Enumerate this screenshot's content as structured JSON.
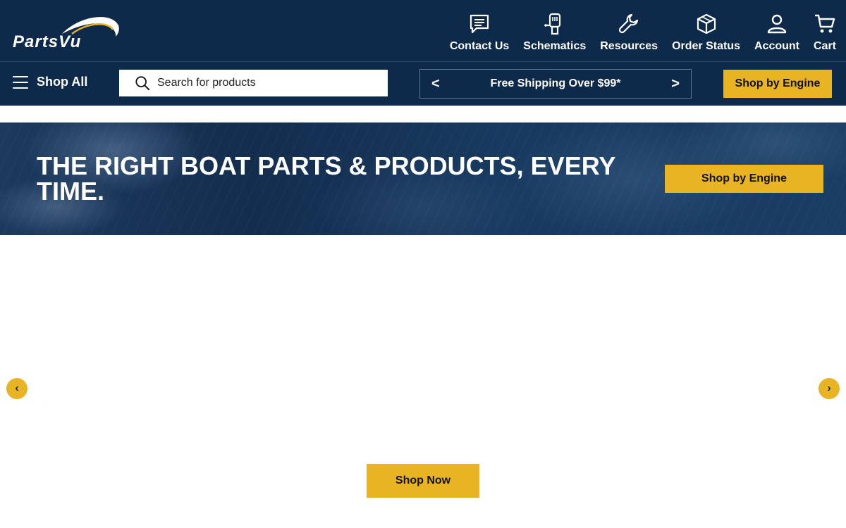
{
  "brand": {
    "logo_text": "PartsVu"
  },
  "nav": {
    "items": [
      {
        "label": "Contact Us",
        "icon": "chat-icon"
      },
      {
        "label": "Schematics",
        "icon": "schematic-icon"
      },
      {
        "label": "Resources",
        "icon": "wrench-icon"
      },
      {
        "label": "Order Status",
        "icon": "box-icon"
      },
      {
        "label": "Account",
        "icon": "user-icon"
      },
      {
        "label": "Cart",
        "icon": "cart-icon"
      }
    ]
  },
  "subbar": {
    "shop_all": "Shop All",
    "search_placeholder": "Search for products",
    "promo_prev": "<",
    "promo_text": "Free Shipping Over $99*",
    "promo_next": ">",
    "engine_button": "Shop by Engine"
  },
  "hero": {
    "title": "THE RIGHT BOAT PARTS & PRODUCTS, EVERY TIME.",
    "engine_button": "Shop by Engine"
  },
  "carousel": {
    "prev": "‹",
    "next": "›",
    "cta": "Shop Now"
  },
  "colors": {
    "navy": "#0e2a4a",
    "accent_yellow": "#e8b423",
    "white": "#ffffff"
  }
}
